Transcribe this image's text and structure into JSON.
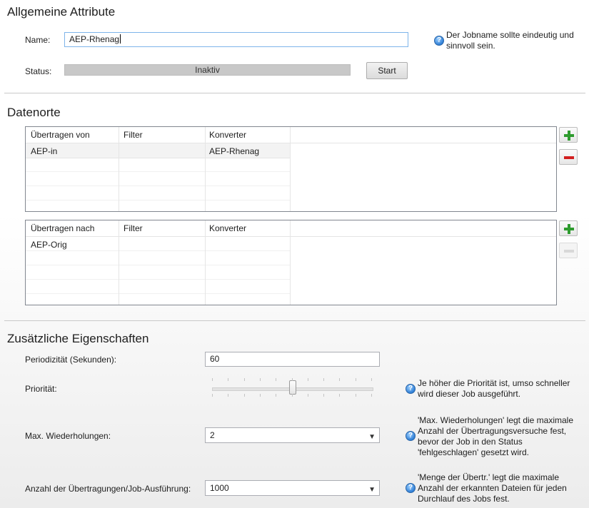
{
  "general": {
    "title": "Allgemeine Attribute",
    "name_label": "Name:",
    "name_value": "AEP-Rhenag",
    "name_hint": [
      "Der Jobname sollte eindeutig und",
      "sinnvoll sein."
    ],
    "status_label": "Status:",
    "status_value": "Inaktiv",
    "start_button": "Start"
  },
  "datenorte": {
    "title": "Datenorte",
    "source_table": {
      "columns": [
        "Übertragen von",
        "Filter",
        "Konverter"
      ],
      "rows": [
        {
          "von": "AEP-in",
          "filter": "",
          "konverter": "AEP-Rhenag"
        }
      ]
    },
    "target_table": {
      "columns": [
        "Übertragen nach",
        "Filter",
        "Konverter"
      ],
      "rows": [
        {
          "nach": "AEP-Orig",
          "filter": "",
          "konverter": ""
        }
      ]
    }
  },
  "extra": {
    "title": "Zusätzliche Eigenschaften",
    "period_label": "Periodizität (Sekunden):",
    "period_value": "60",
    "priority_label": "Priorität:",
    "priority_level": 0.5,
    "priority_hint": [
      "Je höher die Priorität ist, umso schneller",
      "wird dieser Job ausgeführt."
    ],
    "retries_label": "Max. Wiederholungen:",
    "retries_value": "2",
    "retries_hint": [
      "'Max. Wiederholungen' legt die maximale",
      "Anzahl der Übertragungsversuche fest,",
      "bevor der Job in den Status",
      "'fehlgeschlagen' gesetzt wird."
    ],
    "transfers_label": "Anzahl der Übertragungen/Job-Ausführung:",
    "transfers_value": "1000",
    "transfers_hint": [
      "'Menge der Übertr.' legt die maximale",
      "Anzahl der erkannten Dateien für jeden",
      "Durchlauf des Jobs fest."
    ]
  },
  "icons": {
    "add": "plus-icon",
    "remove": "minus-icon",
    "info": "info-icon",
    "dropdown": "chevron-down-icon"
  },
  "colors": {
    "add_green": "#2e9b2e",
    "remove_red": "#d21f1f",
    "info_blue": "#2f7fd6",
    "status_bar": "#c8c8c8"
  }
}
